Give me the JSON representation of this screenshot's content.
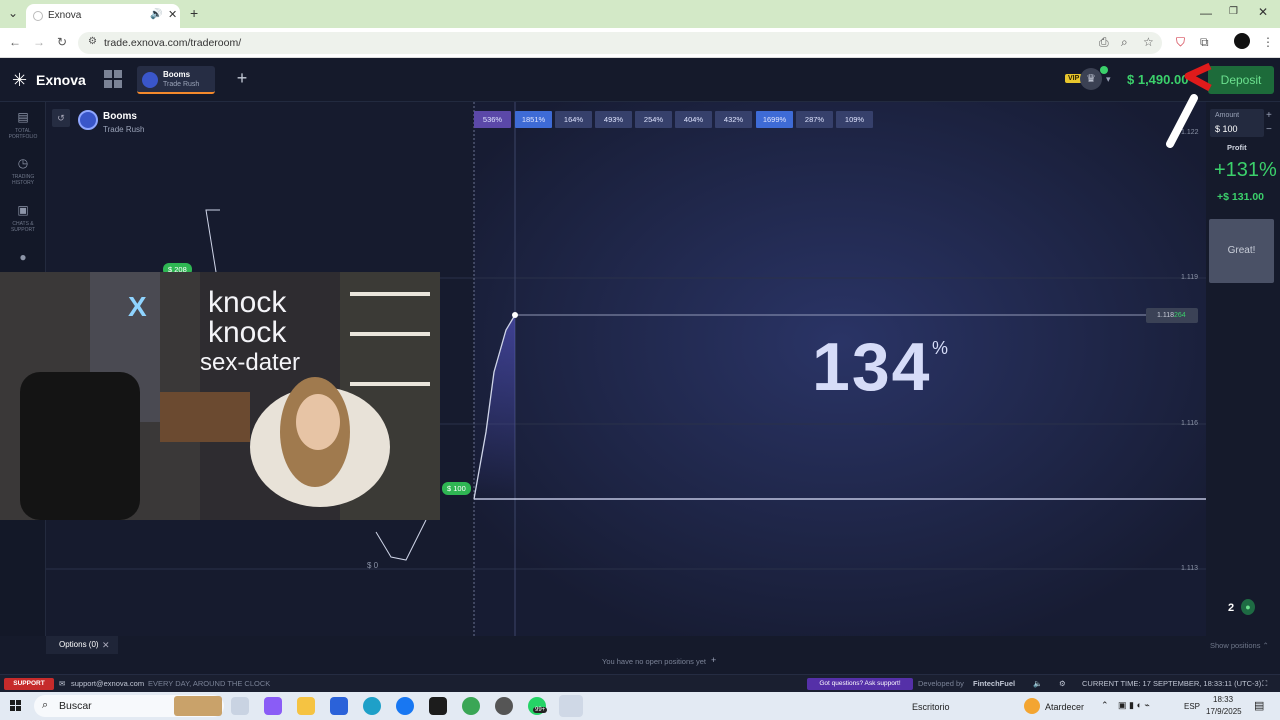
{
  "browser": {
    "tab_title": "Exnova",
    "url": "trade.exnova.com/traderoom/"
  },
  "header": {
    "logo_text": "Exnova",
    "active_asset": {
      "name": "Booms",
      "subtitle": "Trade Rush"
    },
    "vip_badge": "VIP",
    "balance": "$ 1,490.00",
    "deposit_label": "Deposit"
  },
  "sidebar": {
    "items": [
      {
        "label": "TOTAL PORTFOLIO",
        "icon": "briefcase-icon"
      },
      {
        "label": "TRADING HISTORY",
        "icon": "clock-icon"
      },
      {
        "label": "CHATS & SUPPORT",
        "icon": "chat-icon"
      },
      {
        "label": "",
        "icon": "bulb-icon"
      }
    ]
  },
  "chart": {
    "asset_name": "Booms",
    "asset_sub": "Trade Rush",
    "multipliers": [
      "536%",
      "1851%",
      "164%",
      "493%",
      "254%",
      "404%",
      "432%",
      "1699%",
      "287%",
      "109%"
    ],
    "big_percent": "134",
    "big_percent_symbol": "%",
    "y_labels": [
      "1.122",
      "1.119",
      "1.116",
      "1.113"
    ],
    "current_price_prefix": "1.118",
    "current_price_suffix": "264",
    "tag_208": "$ 208",
    "tag_100": "$ 100",
    "tag_0": "$ 0"
  },
  "right_panel": {
    "amount_label": "Amount",
    "amount_value": "$ 100",
    "plus": "+",
    "minus": "−",
    "profit_label": "Profit",
    "profit_percent": "+131%",
    "profit_amount": "+$ 131.00",
    "great_label": "Great!",
    "online_count": "2"
  },
  "options": {
    "tab_label": "Options (0)",
    "no_positions": "You have no open positions yet",
    "show_positions": "Show positions"
  },
  "status_bar": {
    "support_label": "SUPPORT",
    "email": "support@exnova.com",
    "hours": "EVERY DAY, AROUND THE CLOCK",
    "ask_support": "Got questions? Ask support!",
    "developed_by": "Developed by",
    "dev_name": "FintechFuel",
    "current_time": "CURRENT TIME: 17 SEPTEMBER, 18:33:11 (UTC-3)"
  },
  "taskbar": {
    "search_label": "Buscar",
    "desktop_label": "Escritorio",
    "weather_label": "Atardecer",
    "lang": "ESP",
    "time": "18:33",
    "date": "17/9/2025",
    "whatsapp_badge": "99+"
  },
  "colors": {
    "accent_green": "#3bd06b",
    "deposit_bg": "#1d6b3a",
    "chart_bg": "#161b2e",
    "active_pct": "#3e6bd6",
    "pct_bg": "#36406b"
  }
}
